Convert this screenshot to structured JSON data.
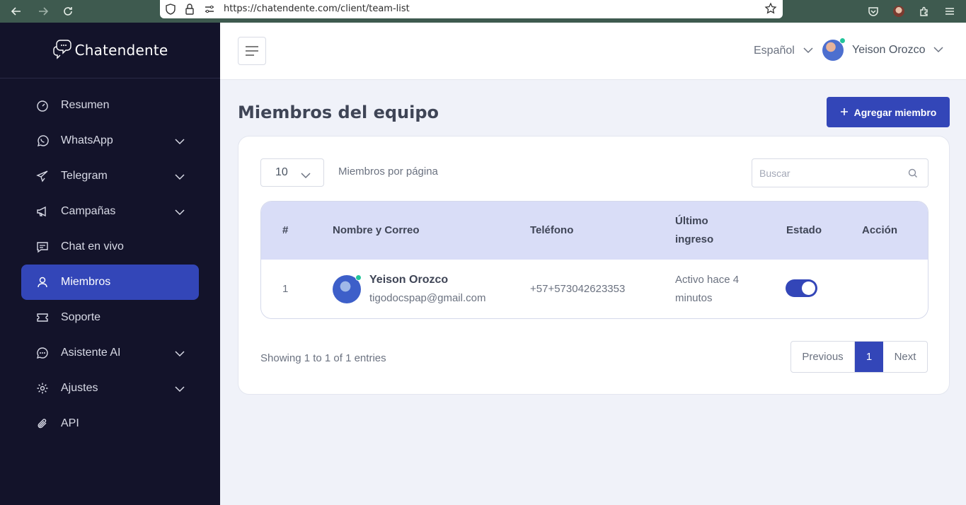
{
  "browser": {
    "url": "https://chatendente.com/client/team-list",
    "icons": [
      "back-arrow-icon",
      "forward-arrow-icon",
      "reload-icon",
      "shield-icon",
      "lock-icon",
      "permissions-icon",
      "bookmark-star-icon",
      "pocket-icon",
      "profile-icon",
      "extensions-icon",
      "menu-icon"
    ]
  },
  "sidebar": {
    "brand": "Chatendente",
    "items": [
      {
        "label": "Resumen",
        "icon": "dashboard-icon",
        "expandable": false,
        "active": false
      },
      {
        "label": "WhatsApp",
        "icon": "whatsapp-icon",
        "expandable": true,
        "active": false
      },
      {
        "label": "Telegram",
        "icon": "telegram-icon",
        "expandable": true,
        "active": false
      },
      {
        "label": "Campañas",
        "icon": "megaphone-icon",
        "expandable": true,
        "active": false
      },
      {
        "label": "Chat en vivo",
        "icon": "chat-icon",
        "expandable": false,
        "active": false
      },
      {
        "label": "Miembros",
        "icon": "user-icon",
        "expandable": false,
        "active": true
      },
      {
        "label": "Soporte",
        "icon": "ticket-icon",
        "expandable": false,
        "active": false
      },
      {
        "label": "Asistente AI",
        "icon": "ai-bubble-icon",
        "expandable": true,
        "active": false
      },
      {
        "label": "Ajustes",
        "icon": "gear-icon",
        "expandable": true,
        "active": false
      },
      {
        "label": "API",
        "icon": "paperclip-icon",
        "expandable": false,
        "active": false
      }
    ]
  },
  "header": {
    "language": "Español",
    "user_name": "Yeison Orozco"
  },
  "main": {
    "title": "Miembros del equipo",
    "add_button": "Agregar miembro",
    "per_page_value": "10",
    "per_page_label": "Miembros por página",
    "search_placeholder": "Buscar",
    "columns": {
      "index": "#",
      "name": "Nombre y Correo",
      "phone": "Teléfono",
      "last_login_1": "Último",
      "last_login_2": "ingreso",
      "status": "Estado",
      "action": "Acción"
    },
    "rows": [
      {
        "index": "1",
        "name": "Yeison Orozco",
        "email": "tigodocspap@gmail.com",
        "phone": "+57+573042623353",
        "last_login_1": "Activo hace 4",
        "last_login_2": "minutos",
        "status_on": true
      }
    ],
    "showing": "Showing 1 to 1 of 1 entries",
    "pager": {
      "previous": "Previous",
      "page": "1",
      "next": "Next"
    }
  },
  "colors": {
    "accent": "#3346b8",
    "sidebar_bg": "#13132a",
    "table_header_bg": "#d9ddf7",
    "online": "#22c59a"
  }
}
